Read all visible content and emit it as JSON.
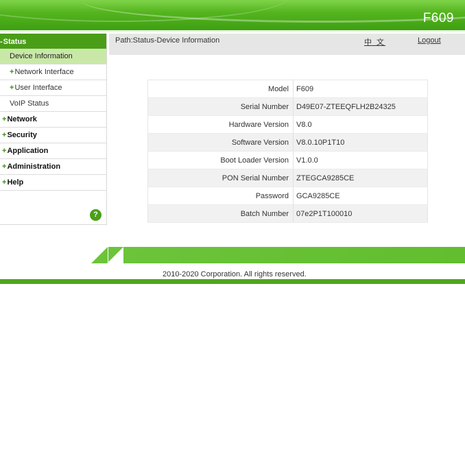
{
  "header": {
    "model": "F609"
  },
  "sidebar": {
    "items": [
      {
        "sign": "-",
        "label": "Status",
        "type": "head"
      },
      {
        "sign": "",
        "label": "Device Information",
        "type": "sel"
      },
      {
        "sign": "+",
        "label": "Network Interface",
        "type": "sub"
      },
      {
        "sign": "+",
        "label": "User Interface",
        "type": "sub"
      },
      {
        "sign": "",
        "label": "VoIP Status",
        "type": "sub"
      },
      {
        "sign": "+",
        "label": "Network",
        "type": "top"
      },
      {
        "sign": "+",
        "label": "Security",
        "type": "top"
      },
      {
        "sign": "+",
        "label": "Application",
        "type": "top"
      },
      {
        "sign": "+",
        "label": "Administration",
        "type": "top"
      },
      {
        "sign": "+",
        "label": "Help",
        "type": "top"
      }
    ],
    "help_icon": "?"
  },
  "pathbar": {
    "path": "Path:Status-Device Information",
    "language": "中 文",
    "logout": "Logout"
  },
  "device_info": [
    {
      "label": "Model",
      "value": "F609"
    },
    {
      "label": "Serial Number",
      "value": "D49E07-ZTEEQFLH2B24325"
    },
    {
      "label": "Hardware Version",
      "value": "V8.0"
    },
    {
      "label": "Software Version",
      "value": "V8.0.10P1T10"
    },
    {
      "label": "Boot Loader Version",
      "value": "V1.0.0"
    },
    {
      "label": "PON Serial Number",
      "value": "ZTEGCA9285CE"
    },
    {
      "label": "Password",
      "value": "GCA9285CE"
    },
    {
      "label": "Batch Number",
      "value": "07e2P1T100010"
    }
  ],
  "footer": {
    "copyright": "2010-2020 Corporation. All rights reserved."
  },
  "colors": {
    "brand_green": "#4a9e17",
    "selected_bg": "#c9e8a8",
    "pathbar_bg": "#e6e6e6"
  }
}
